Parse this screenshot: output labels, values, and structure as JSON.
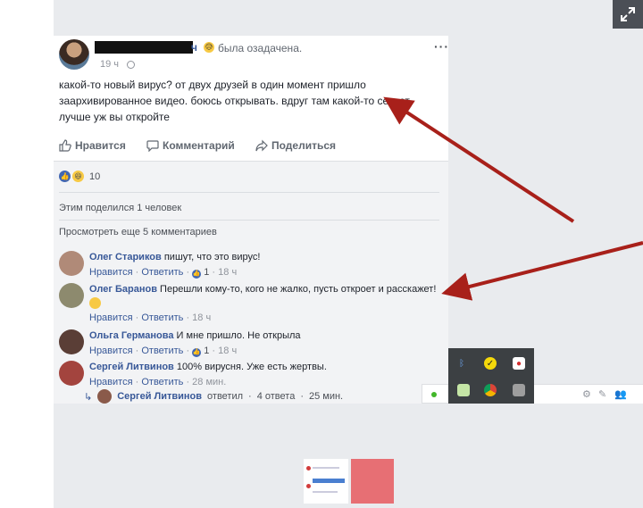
{
  "post": {
    "author_suffix": "ч",
    "feeling_emoji": "😥",
    "feeling": "была озадачена.",
    "time": "19 ч",
    "more": "···",
    "text": "какой-то новый вирус? от двух друзей в один момент пришло заархивированное видео. боюсь открывать. вдруг там какой-то секрет. лучше уж вы откройте"
  },
  "actions": {
    "like": "Нравится",
    "comment": "Комментарий",
    "share": "Поделиться"
  },
  "reactions": {
    "count": "10"
  },
  "shared_text": "Этим поделился 1 человек",
  "view_more": "Просмотреть еще 5 комментариев",
  "meta": {
    "like": "Нравится",
    "reply": "Ответить",
    "sep": "·"
  },
  "comments": [
    {
      "name": "Олег Стариков",
      "text": " пишут, что это вирус!",
      "likes": "1",
      "time": "18 ч"
    },
    {
      "name": "Олег Баранов",
      "text": " Перешли кому-то, кого не жалко, пусть откроет и расскажет!",
      "time": "18 ч"
    },
    {
      "name": "Ольга Германова",
      "text": " И мне пришло. Не открыла",
      "likes": "1",
      "time": "18 ч"
    },
    {
      "name": "Сергей Литвинов",
      "text": " 100% вирусня. Уже есть жертвы.",
      "time": "28 мин."
    }
  ],
  "reply": {
    "name": "Сергей Литвинов",
    "action": "ответил",
    "count": "4 ответа",
    "time": "25 мин."
  },
  "colors": {
    "link": "#385898",
    "arrow": "#a8201a",
    "page_bg": "#e9ebee",
    "tray_bg": "#3c4043"
  },
  "icons": [
    "expand-icon",
    "thumbs-up-icon",
    "comment-icon",
    "share-icon",
    "bluetooth-icon",
    "norton-icon",
    "antivirus-icon",
    "notes-icon",
    "chrome-icon",
    "speaker-icon",
    "gear-icon",
    "compose-icon",
    "people-icon"
  ]
}
